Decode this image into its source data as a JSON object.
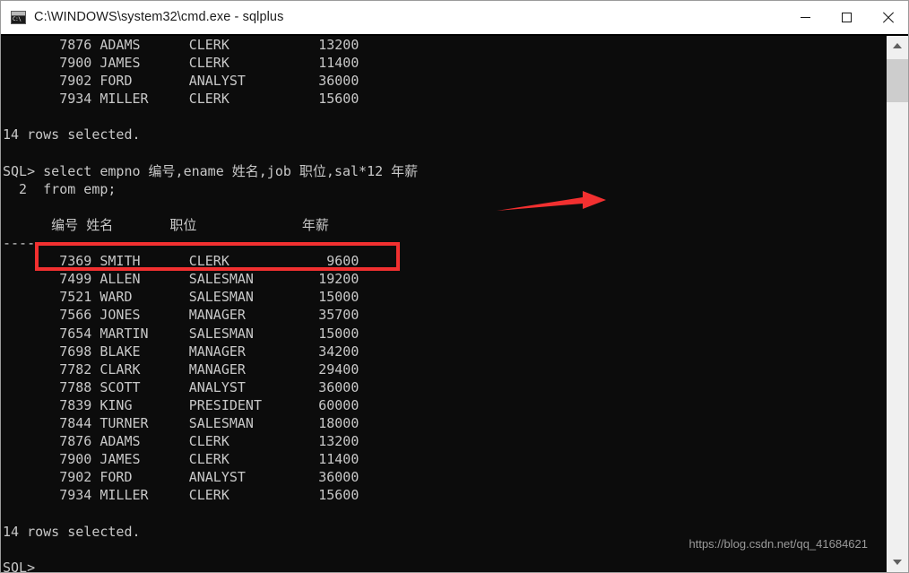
{
  "window": {
    "title": "C:\\WINDOWS\\system32\\cmd.exe - sqlplus",
    "icon": "cmd-console-icon",
    "controls": {
      "minimize_label": "—",
      "maximize_label": "□",
      "close_label": "✕"
    }
  },
  "console": {
    "background_color": "#0c0c0c",
    "text_color": "#c8c8c8",
    "lines": [
      "       7876 ADAMS      CLERK           13200",
      "       7900 JAMES      CLERK           11400",
      "       7902 FORD       ANALYST         36000",
      "       7934 MILLER     CLERK           15600",
      "",
      "14 rows selected.",
      "",
      "SQL> select empno 编号,ename 姓名,job 职位,sal*12 年薪",
      "  2  from emp;",
      "",
      "      编号 姓名       职位             年薪",
      "---------- ---------- --------- ----------",
      "       7369 SMITH      CLERK            9600",
      "       7499 ALLEN      SALESMAN        19200",
      "       7521 WARD       SALESMAN        15000",
      "       7566 JONES      MANAGER         35700",
      "       7654 MARTIN     SALESMAN        15000",
      "       7698 BLAKE      MANAGER         34200",
      "       7782 CLARK      MANAGER         29400",
      "       7788 SCOTT      ANALYST         36000",
      "       7839 KING       PRESIDENT       60000",
      "       7844 TURNER     SALESMAN        18000",
      "       7876 ADAMS      CLERK           13200",
      "       7900 JAMES      CLERK           11400",
      "       7902 FORD       ANALYST         36000",
      "       7934 MILLER     CLERK           15600",
      "",
      "14 rows selected.",
      "",
      "SQL>"
    ]
  },
  "query": {
    "prompt": "SQL>",
    "statement_line1": "select empno 编号,ename 姓名,job 职位,sal*12 年薪",
    "continuation_number": "2",
    "statement_line2": "from emp;",
    "result_count_text": "14 rows selected."
  },
  "result_table": {
    "headers": [
      "编号",
      "姓名",
      "职位",
      "年薪"
    ],
    "separator": "---------- ---------- --------- ----------",
    "rows": [
      [
        "7369",
        "SMITH",
        "CLERK",
        "9600"
      ],
      [
        "7499",
        "ALLEN",
        "SALESMAN",
        "19200"
      ],
      [
        "7521",
        "WARD",
        "SALESMAN",
        "15000"
      ],
      [
        "7566",
        "JONES",
        "MANAGER",
        "35700"
      ],
      [
        "7654",
        "MARTIN",
        "SALESMAN",
        "15000"
      ],
      [
        "7698",
        "BLAKE",
        "MANAGER",
        "34200"
      ],
      [
        "7782",
        "CLARK",
        "MANAGER",
        "29400"
      ],
      [
        "7788",
        "SCOTT",
        "ANALYST",
        "36000"
      ],
      [
        "7839",
        "KING",
        "PRESIDENT",
        "60000"
      ],
      [
        "7844",
        "TURNER",
        "SALESMAN",
        "18000"
      ],
      [
        "7876",
        "ADAMS",
        "CLERK",
        "13200"
      ],
      [
        "7900",
        "JAMES",
        "CLERK",
        "11400"
      ],
      [
        "7902",
        "FORD",
        "ANALYST",
        "36000"
      ],
      [
        "7934",
        "MILLER",
        "CLERK",
        "15600"
      ]
    ]
  },
  "annotations": {
    "highlight_box": {
      "color": "#f23030",
      "target": "column-header-row"
    },
    "arrow": {
      "color": "#f23030",
      "direction": "right",
      "target": "select-statement-aliases"
    }
  },
  "watermark": {
    "text": "https://blog.csdn.net/qq_41684621"
  },
  "scrollbar": {
    "up_arrow": "scroll-up-icon",
    "down_arrow": "scroll-down-icon",
    "thumb": "scroll-thumb"
  }
}
